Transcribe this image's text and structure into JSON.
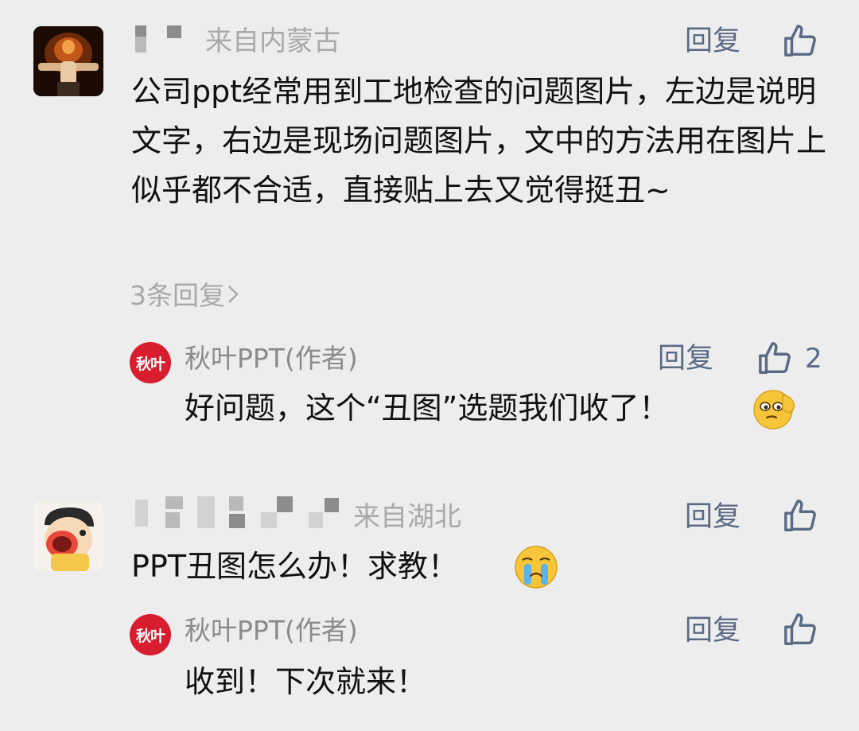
{
  "comments": [
    {
      "location": "来自内蒙古",
      "reply_label": "回复",
      "text": "公司ppt经常用到工地检查的问题图片，左边是说明文字，右边是现场问题图片，文中的方法用在图片上似乎都不合适，直接贴上去又觉得挺丑~",
      "replies_link": "3条回复",
      "author_reply": {
        "badge": "秋叶",
        "name": "秋叶PPT(作者)",
        "reply_label": "回复",
        "likes": "2",
        "text": "好问题，这个“丑图”选题我们收了！",
        "emoji": "thinking-face-emoji"
      }
    },
    {
      "location": "来自湖北",
      "reply_label": "回复",
      "text": "PPT丑图怎么办！求教！",
      "emoji": "crying-face-emoji",
      "author_reply": {
        "badge": "秋叶",
        "name": "秋叶PPT(作者)",
        "reply_label": "回复",
        "text": "收到！下次就来！"
      }
    }
  ],
  "colors": {
    "background": "#ededed",
    "link": "#5a6a85",
    "badge": "#d81e2e"
  }
}
